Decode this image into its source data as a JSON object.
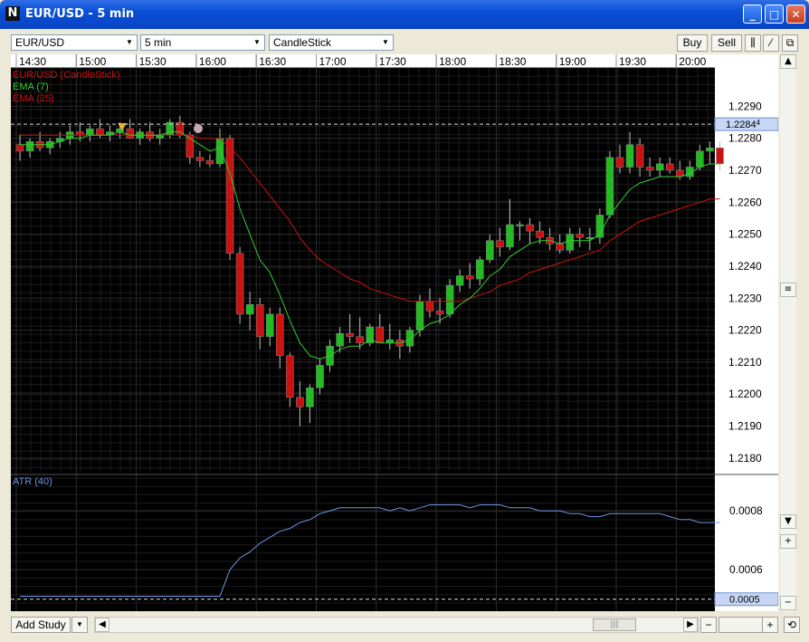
{
  "window": {
    "title": "EUR/USD - 5 min"
  },
  "toolbar": {
    "instrument": "EUR/USD",
    "interval": "5 min",
    "chart_style": "CandleStick",
    "buy_label": "Buy",
    "sell_label": "Sell"
  },
  "legend": {
    "main": "EUR/USD (CandleStick)",
    "ema7": "EMA (7)",
    "ema25": "EMA (25)",
    "atr": "ATR (40)"
  },
  "bottom": {
    "add_study_label": "Add Study"
  },
  "colors": {
    "background": "#000000",
    "up": "#22bb22",
    "down": "#cc1111",
    "ema7": "#33cc33",
    "ema25": "#cc1111",
    "atr": "#6f95e3",
    "axis_bg": "#ffffff"
  },
  "chart_data": [
    {
      "type": "candlestick",
      "title": "EUR/USD (CandleStick)",
      "x_tick_labels": [
        "14:30",
        "15:00",
        "15:30",
        "16:00",
        "16:30",
        "17:00",
        "17:30",
        "18:00",
        "18:30",
        "19:00",
        "19:30",
        "20:00"
      ],
      "y_tick_labels": [
        "1.2290",
        "1.2280",
        "1.2270",
        "1.2260",
        "1.2250",
        "1.2240",
        "1.2230",
        "1.2220",
        "1.2210",
        "1.2200",
        "1.2190",
        "1.2180"
      ],
      "ylim": [
        1.2176,
        1.2302
      ],
      "current_price": "1.2284",
      "current_price_suffix": "4",
      "current_price_value": 1.22844,
      "grid": true,
      "candles": [
        [
          1.2278,
          1.2281,
          1.2273,
          1.2276
        ],
        [
          1.2276,
          1.228,
          1.2274,
          1.2279
        ],
        [
          1.2279,
          1.2282,
          1.2276,
          1.2277
        ],
        [
          1.2277,
          1.228,
          1.2275,
          1.2279
        ],
        [
          1.2279,
          1.2282,
          1.2277,
          1.228
        ],
        [
          1.228,
          1.2284,
          1.2278,
          1.2282
        ],
        [
          1.2282,
          1.2285,
          1.2279,
          1.2281
        ],
        [
          1.2281,
          1.2284,
          1.2279,
          1.2283
        ],
        [
          1.2283,
          1.2286,
          1.228,
          1.2281
        ],
        [
          1.2281,
          1.2284,
          1.2279,
          1.2282
        ],
        [
          1.2282,
          1.2285,
          1.228,
          1.2283
        ],
        [
          1.2283,
          1.2286,
          1.228,
          1.228
        ],
        [
          1.228,
          1.2283,
          1.2278,
          1.2282
        ],
        [
          1.2282,
          1.2285,
          1.2279,
          1.228
        ],
        [
          1.228,
          1.2283,
          1.2278,
          1.2281
        ],
        [
          1.2281,
          1.2286,
          1.228,
          1.2285
        ],
        [
          1.2285,
          1.2287,
          1.228,
          1.2281
        ],
        [
          1.2281,
          1.2282,
          1.2272,
          1.2274
        ],
        [
          1.2274,
          1.2276,
          1.2271,
          1.2273
        ],
        [
          1.2273,
          1.2275,
          1.2271,
          1.2272
        ],
        [
          1.2272,
          1.2283,
          1.2271,
          1.228
        ],
        [
          1.228,
          1.2281,
          1.2242,
          1.2244
        ],
        [
          1.2244,
          1.2246,
          1.2222,
          1.2225
        ],
        [
          1.2225,
          1.2232,
          1.222,
          1.2228
        ],
        [
          1.2228,
          1.223,
          1.2214,
          1.2218
        ],
        [
          1.2218,
          1.2227,
          1.2215,
          1.2225
        ],
        [
          1.2225,
          1.2227,
          1.2208,
          1.2212
        ],
        [
          1.2212,
          1.2213,
          1.2196,
          1.2199
        ],
        [
          1.2199,
          1.2204,
          1.219,
          1.2196
        ],
        [
          1.2196,
          1.2203,
          1.2191,
          1.2202
        ],
        [
          1.2202,
          1.2211,
          1.22,
          1.2209
        ],
        [
          1.2209,
          1.2217,
          1.2207,
          1.2215
        ],
        [
          1.2215,
          1.2221,
          1.2213,
          1.2219
        ],
        [
          1.2219,
          1.2225,
          1.2216,
          1.2218
        ],
        [
          1.2218,
          1.2224,
          1.2214,
          1.2216
        ],
        [
          1.2216,
          1.2222,
          1.2215,
          1.2221
        ],
        [
          1.2221,
          1.2225,
          1.2218,
          1.2216
        ],
        [
          1.2216,
          1.2222,
          1.2214,
          1.2217
        ],
        [
          1.2217,
          1.222,
          1.2211,
          1.2215
        ],
        [
          1.2215,
          1.2221,
          1.2213,
          1.222
        ],
        [
          1.222,
          1.2231,
          1.2218,
          1.2229
        ],
        [
          1.2229,
          1.2233,
          1.2224,
          1.2226
        ],
        [
          1.2226,
          1.223,
          1.2222,
          1.2225
        ],
        [
          1.2225,
          1.2236,
          1.2224,
          1.2234
        ],
        [
          1.2234,
          1.2239,
          1.2232,
          1.2237
        ],
        [
          1.2237,
          1.2241,
          1.2233,
          1.2236
        ],
        [
          1.2236,
          1.2243,
          1.2234,
          1.2242
        ],
        [
          1.2242,
          1.225,
          1.2241,
          1.2248
        ],
        [
          1.2248,
          1.2252,
          1.2243,
          1.2246
        ],
        [
          1.2246,
          1.2261,
          1.2245,
          1.2253
        ],
        [
          1.2253,
          1.2254,
          1.2248,
          1.2253
        ],
        [
          1.2253,
          1.2255,
          1.2247,
          1.2251
        ],
        [
          1.2251,
          1.2254,
          1.2247,
          1.2249
        ],
        [
          1.2249,
          1.2252,
          1.2245,
          1.2247
        ],
        [
          1.2247,
          1.225,
          1.2244,
          1.2245
        ],
        [
          1.2245,
          1.2252,
          1.2244,
          1.225
        ],
        [
          1.225,
          1.2252,
          1.2246,
          1.2249
        ],
        [
          1.2249,
          1.2252,
          1.2245,
          1.2249
        ],
        [
          1.2249,
          1.2258,
          1.2247,
          1.2256
        ],
        [
          1.2256,
          1.2276,
          1.2255,
          1.2274
        ],
        [
          1.2274,
          1.2278,
          1.2269,
          1.2271
        ],
        [
          1.2271,
          1.2282,
          1.2269,
          1.2278
        ],
        [
          1.2278,
          1.228,
          1.2268,
          1.2271
        ],
        [
          1.2271,
          1.2274,
          1.2268,
          1.227
        ],
        [
          1.227,
          1.2274,
          1.2268,
          1.2272
        ],
        [
          1.2272,
          1.2274,
          1.2269,
          1.227
        ],
        [
          1.227,
          1.2273,
          1.2267,
          1.2268
        ],
        [
          1.2268,
          1.2273,
          1.2267,
          1.2271
        ],
        [
          1.2271,
          1.2278,
          1.227,
          1.2276
        ],
        [
          1.2276,
          1.2279,
          1.2272,
          1.2277
        ],
        [
          1.2277,
          1.2279,
          1.227,
          1.2272
        ]
      ],
      "ema7": [
        1.2278,
        1.2278,
        1.2278,
        1.2278,
        1.2279,
        1.228,
        1.228,
        1.2281,
        1.2281,
        1.2281,
        1.2282,
        1.2281,
        1.2281,
        1.2281,
        1.2281,
        1.2282,
        1.2282,
        1.228,
        1.2278,
        1.2276,
        1.2277,
        1.2269,
        1.2258,
        1.225,
        1.2242,
        1.2238,
        1.2231,
        1.2223,
        1.2216,
        1.2212,
        1.2211,
        1.2212,
        1.2214,
        1.2215,
        1.2215,
        1.2217,
        1.2216,
        1.2216,
        1.2216,
        1.2217,
        1.222,
        1.2222,
        1.2223,
        1.2225,
        1.2228,
        1.223,
        1.2233,
        1.2237,
        1.2239,
        1.2243,
        1.2245,
        1.2247,
        1.2248,
        1.2248,
        1.2247,
        1.2248,
        1.2248,
        1.2248,
        1.225,
        1.2256,
        1.226,
        1.2264,
        1.2266,
        1.2267,
        1.2268,
        1.2268,
        1.2268,
        1.2269,
        1.2271,
        1.2272,
        1.2272
      ],
      "ema25": [
        1.2281,
        1.2281,
        1.2281,
        1.2281,
        1.2281,
        1.2281,
        1.2281,
        1.2281,
        1.2281,
        1.2281,
        1.2281,
        1.2281,
        1.2281,
        1.2281,
        1.2281,
        1.2281,
        1.2281,
        1.2281,
        1.228,
        1.228,
        1.228,
        1.2277,
        1.2274,
        1.227,
        1.2266,
        1.2262,
        1.2258,
        1.2254,
        1.2249,
        1.2245,
        1.2242,
        1.224,
        1.2238,
        1.2236,
        1.2235,
        1.2233,
        1.2232,
        1.2231,
        1.223,
        1.2229,
        1.2229,
        1.2229,
        1.2229,
        1.2229,
        1.2229,
        1.223,
        1.2231,
        1.2232,
        1.2234,
        1.2235,
        1.2236,
        1.2238,
        1.2239,
        1.224,
        1.2241,
        1.2242,
        1.2243,
        1.2244,
        1.2245,
        1.2248,
        1.225,
        1.2252,
        1.2254,
        1.2255,
        1.2256,
        1.2257,
        1.2258,
        1.2259,
        1.226,
        1.2261,
        1.2261
      ]
    },
    {
      "type": "line",
      "title": "ATR (40)",
      "y_tick_labels": [
        "0.0008",
        "0.0006"
      ],
      "ylim": [
        0.00049,
        0.00088
      ],
      "current_value": "0.0005",
      "current_value_number": 0.0005,
      "values": [
        0.00051,
        0.00051,
        0.00051,
        0.00051,
        0.00051,
        0.00051,
        0.00051,
        0.00051,
        0.00051,
        0.00051,
        0.00051,
        0.00051,
        0.00051,
        0.00051,
        0.00051,
        0.00051,
        0.00051,
        0.00051,
        0.00051,
        0.00051,
        0.00051,
        0.0006,
        0.00064,
        0.00066,
        0.00069,
        0.00071,
        0.00073,
        0.00074,
        0.00076,
        0.00077,
        0.00079,
        0.0008,
        0.00081,
        0.00081,
        0.00081,
        0.00081,
        0.00081,
        0.0008,
        0.00081,
        0.0008,
        0.00081,
        0.00082,
        0.00082,
        0.00082,
        0.00082,
        0.00081,
        0.00082,
        0.00082,
        0.00082,
        0.00081,
        0.00081,
        0.00081,
        0.0008,
        0.0008,
        0.0008,
        0.00079,
        0.00079,
        0.00078,
        0.00078,
        0.00079,
        0.00079,
        0.00079,
        0.00079,
        0.00079,
        0.00079,
        0.00078,
        0.00077,
        0.00077,
        0.00076,
        0.00076,
        0.00076
      ]
    }
  ]
}
